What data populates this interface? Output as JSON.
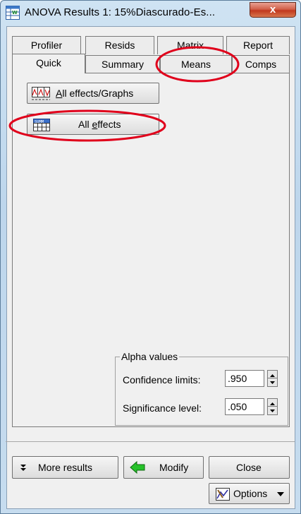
{
  "window": {
    "title": "ANOVA Results 1: 15%Diascurado-Es...",
    "close_label": "x"
  },
  "tabs": {
    "row1": [
      "Profiler",
      "Resids",
      "Matrix",
      "Report"
    ],
    "row2": [
      "Quick",
      "Summary",
      "Means",
      "Comps"
    ],
    "active": "Quick"
  },
  "buttons": {
    "all_effects_graphs": {
      "first_letter": "A",
      "rest": "ll effects/Graphs"
    },
    "all_effects": {
      "prefix": "All ",
      "underlined": "e",
      "rest": "ffects"
    }
  },
  "alpha": {
    "legend": "Alpha values",
    "confidence_label": "Confidence limits:",
    "confidence_value": ".950",
    "significance_label": "Significance level:",
    "significance_value": ".050"
  },
  "footer": {
    "more_results": "More results",
    "modify": "Modify",
    "close": "Close",
    "options": "Options"
  },
  "icons": {
    "app": "spreadsheet-icon",
    "graphs": "graph-grid-icon",
    "summary": "summary-table-icon",
    "more": "double-chevron-down-icon",
    "modify": "green-left-arrow-icon",
    "options": "chart-options-icon"
  },
  "colors": {
    "annotation": "#e0001b",
    "modify_arrow": "#26c22a",
    "close_button": "#c2381d"
  }
}
